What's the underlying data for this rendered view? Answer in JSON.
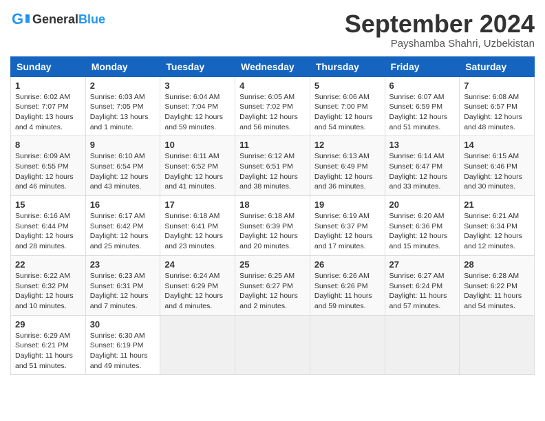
{
  "header": {
    "logo_general": "General",
    "logo_blue": "Blue",
    "month_title": "September 2024",
    "subtitle": "Payshamba Shahri, Uzbekistan"
  },
  "weekdays": [
    "Sunday",
    "Monday",
    "Tuesday",
    "Wednesday",
    "Thursday",
    "Friday",
    "Saturday"
  ],
  "weeks": [
    [
      {
        "day": "1",
        "sunrise": "6:02 AM",
        "sunset": "7:07 PM",
        "daylight": "13 hours and 4 minutes."
      },
      {
        "day": "2",
        "sunrise": "6:03 AM",
        "sunset": "7:05 PM",
        "daylight": "13 hours and 1 minute."
      },
      {
        "day": "3",
        "sunrise": "6:04 AM",
        "sunset": "7:04 PM",
        "daylight": "12 hours and 59 minutes."
      },
      {
        "day": "4",
        "sunrise": "6:05 AM",
        "sunset": "7:02 PM",
        "daylight": "12 hours and 56 minutes."
      },
      {
        "day": "5",
        "sunrise": "6:06 AM",
        "sunset": "7:00 PM",
        "daylight": "12 hours and 54 minutes."
      },
      {
        "day": "6",
        "sunrise": "6:07 AM",
        "sunset": "6:59 PM",
        "daylight": "12 hours and 51 minutes."
      },
      {
        "day": "7",
        "sunrise": "6:08 AM",
        "sunset": "6:57 PM",
        "daylight": "12 hours and 48 minutes."
      }
    ],
    [
      {
        "day": "8",
        "sunrise": "6:09 AM",
        "sunset": "6:55 PM",
        "daylight": "12 hours and 46 minutes."
      },
      {
        "day": "9",
        "sunrise": "6:10 AM",
        "sunset": "6:54 PM",
        "daylight": "12 hours and 43 minutes."
      },
      {
        "day": "10",
        "sunrise": "6:11 AM",
        "sunset": "6:52 PM",
        "daylight": "12 hours and 41 minutes."
      },
      {
        "day": "11",
        "sunrise": "6:12 AM",
        "sunset": "6:51 PM",
        "daylight": "12 hours and 38 minutes."
      },
      {
        "day": "12",
        "sunrise": "6:13 AM",
        "sunset": "6:49 PM",
        "daylight": "12 hours and 36 minutes."
      },
      {
        "day": "13",
        "sunrise": "6:14 AM",
        "sunset": "6:47 PM",
        "daylight": "12 hours and 33 minutes."
      },
      {
        "day": "14",
        "sunrise": "6:15 AM",
        "sunset": "6:46 PM",
        "daylight": "12 hours and 30 minutes."
      }
    ],
    [
      {
        "day": "15",
        "sunrise": "6:16 AM",
        "sunset": "6:44 PM",
        "daylight": "12 hours and 28 minutes."
      },
      {
        "day": "16",
        "sunrise": "6:17 AM",
        "sunset": "6:42 PM",
        "daylight": "12 hours and 25 minutes."
      },
      {
        "day": "17",
        "sunrise": "6:18 AM",
        "sunset": "6:41 PM",
        "daylight": "12 hours and 23 minutes."
      },
      {
        "day": "18",
        "sunrise": "6:18 AM",
        "sunset": "6:39 PM",
        "daylight": "12 hours and 20 minutes."
      },
      {
        "day": "19",
        "sunrise": "6:19 AM",
        "sunset": "6:37 PM",
        "daylight": "12 hours and 17 minutes."
      },
      {
        "day": "20",
        "sunrise": "6:20 AM",
        "sunset": "6:36 PM",
        "daylight": "12 hours and 15 minutes."
      },
      {
        "day": "21",
        "sunrise": "6:21 AM",
        "sunset": "6:34 PM",
        "daylight": "12 hours and 12 minutes."
      }
    ],
    [
      {
        "day": "22",
        "sunrise": "6:22 AM",
        "sunset": "6:32 PM",
        "daylight": "12 hours and 10 minutes."
      },
      {
        "day": "23",
        "sunrise": "6:23 AM",
        "sunset": "6:31 PM",
        "daylight": "12 hours and 7 minutes."
      },
      {
        "day": "24",
        "sunrise": "6:24 AM",
        "sunset": "6:29 PM",
        "daylight": "12 hours and 4 minutes."
      },
      {
        "day": "25",
        "sunrise": "6:25 AM",
        "sunset": "6:27 PM",
        "daylight": "12 hours and 2 minutes."
      },
      {
        "day": "26",
        "sunrise": "6:26 AM",
        "sunset": "6:26 PM",
        "daylight": "11 hours and 59 minutes."
      },
      {
        "day": "27",
        "sunrise": "6:27 AM",
        "sunset": "6:24 PM",
        "daylight": "11 hours and 57 minutes."
      },
      {
        "day": "28",
        "sunrise": "6:28 AM",
        "sunset": "6:22 PM",
        "daylight": "11 hours and 54 minutes."
      }
    ],
    [
      {
        "day": "29",
        "sunrise": "6:29 AM",
        "sunset": "6:21 PM",
        "daylight": "11 hours and 51 minutes."
      },
      {
        "day": "30",
        "sunrise": "6:30 AM",
        "sunset": "6:19 PM",
        "daylight": "11 hours and 49 minutes."
      },
      null,
      null,
      null,
      null,
      null
    ]
  ]
}
